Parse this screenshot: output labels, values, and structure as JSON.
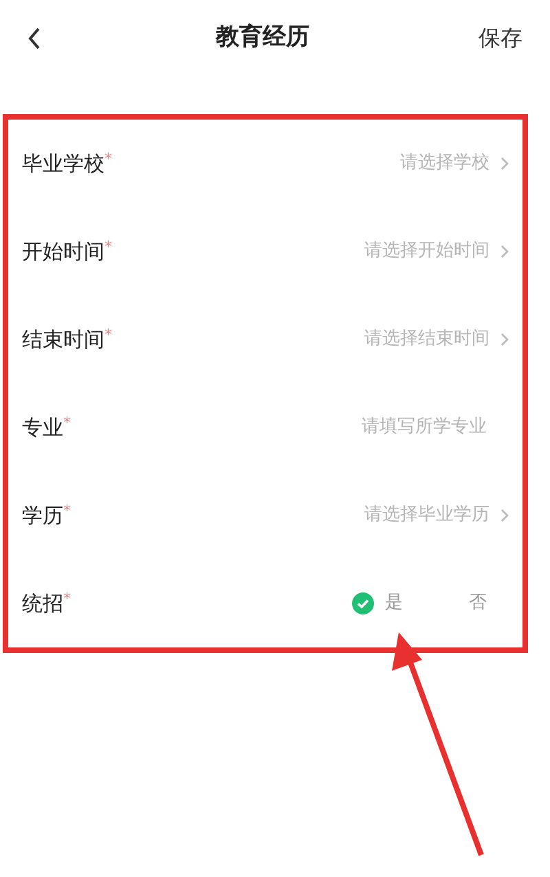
{
  "header": {
    "title": "教育经历",
    "save": "保存"
  },
  "fields": [
    {
      "kind": "select",
      "label": "毕业学校",
      "mark": "*",
      "placeholder": "请选择学校"
    },
    {
      "kind": "select",
      "label": "开始时间",
      "mark": "*",
      "placeholder": "请选择开始时间"
    },
    {
      "kind": "select",
      "label": "结束时间",
      "mark": "*",
      "placeholder": "请选择结束时间"
    },
    {
      "kind": "input",
      "label": "专业",
      "mark": "*",
      "placeholder": "请填写所学专业"
    },
    {
      "kind": "select",
      "label": "学历",
      "mark": "*",
      "placeholder": "请选择毕业学历"
    },
    {
      "kind": "radio",
      "label": "统招",
      "mark": "*",
      "options": [
        {
          "label": "是",
          "selected": true
        },
        {
          "label": "否",
          "selected": false
        }
      ]
    }
  ]
}
